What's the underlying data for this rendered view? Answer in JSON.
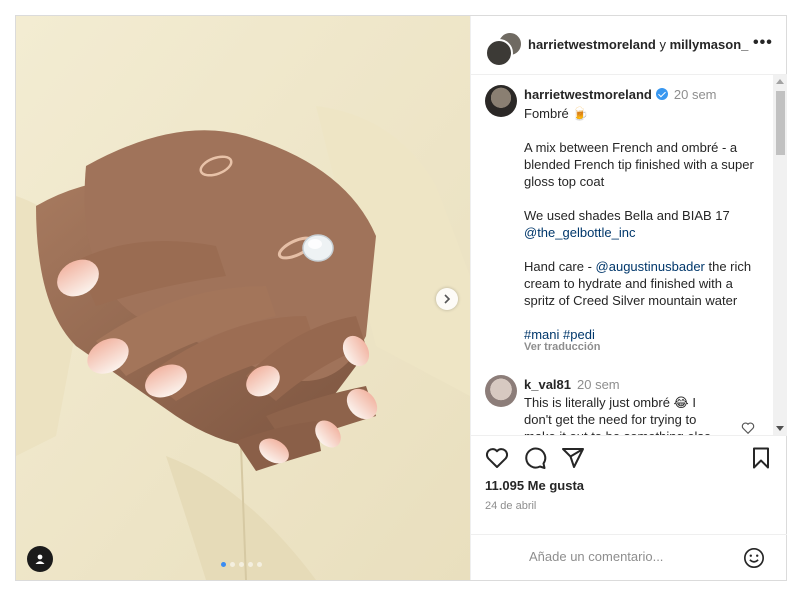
{
  "header": {
    "user1": "harrietwestmoreland",
    "joiner": "y",
    "user2": "millymason_",
    "more": "•••"
  },
  "caption": {
    "username": "harrietwestmoreland",
    "time": "20 sem",
    "lines": {
      "l1": "Fombré 🍺",
      "p1": "A mix between French and ombré - a blended French tip finished with a super gloss top coat",
      "p2a": "We used shades Bella and BIAB 17",
      "p2b": "@the_gelbottle_inc",
      "p3a": "Hand care - ",
      "p3link": "@augustinusbader",
      "p3b": " the rich cream to hydrate and finished with a spritz of Creed Silver mountain water",
      "tags": "#mani #pedi"
    },
    "translate": "Ver traducción"
  },
  "comment": {
    "username": "k_val81",
    "time": "20 sem",
    "text": "This is literally just ombré 😂 I don't get the need for trying to make it out to be something else"
  },
  "stats": {
    "likes": "11.095 Me gusta",
    "date": "24 de abril"
  },
  "composer": {
    "placeholder": "Añade un comentario..."
  },
  "colors": {
    "verified": "#3897f0",
    "link": "#00376b",
    "carousel_active_dot": "#3b8cf2"
  }
}
